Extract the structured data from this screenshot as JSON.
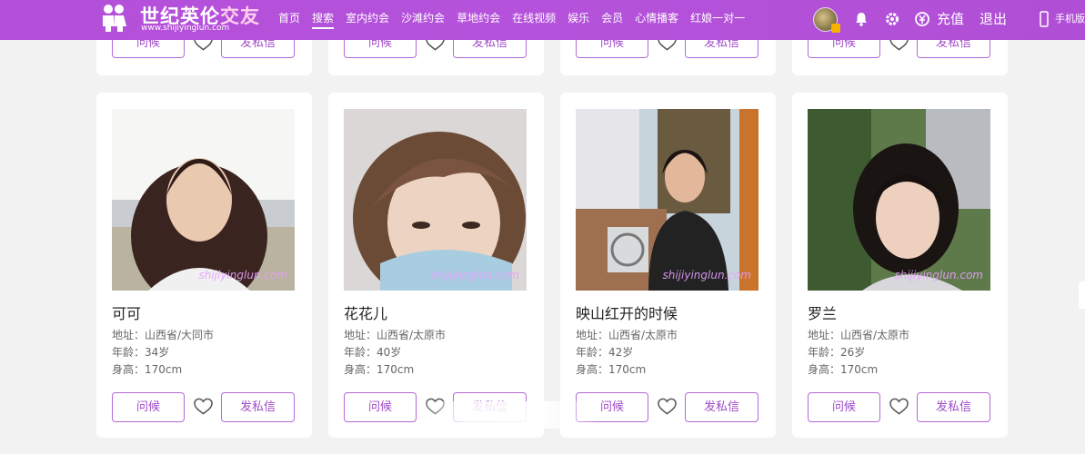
{
  "header": {
    "logo_title_main": "世纪英伦",
    "logo_title_accent": "交友",
    "logo_url": "www.shijiyinglun.com",
    "nav": [
      {
        "label": "首页",
        "active": false
      },
      {
        "label": "搜索",
        "active": true
      },
      {
        "label": "室内约会",
        "active": false
      },
      {
        "label": "沙滩约会",
        "active": false
      },
      {
        "label": "草地约会",
        "active": false
      },
      {
        "label": "在线视频",
        "active": false
      },
      {
        "label": "娱乐",
        "active": false
      },
      {
        "label": "会员",
        "active": false
      },
      {
        "label": "心情播客",
        "active": false
      },
      {
        "label": "红娘一对一",
        "active": false
      }
    ],
    "recharge_label": "充值",
    "logout_label": "退出",
    "mobile_label": "手机版"
  },
  "buttons": {
    "greet": "问候",
    "message": "发私信"
  },
  "watermark": "shijiyinglun.com",
  "labels": {
    "address": "地址：",
    "age": "年龄：",
    "height": "身高："
  },
  "profiles": [
    {
      "name": "可可",
      "address": "山西省/大同市",
      "age": "34岁",
      "height": "170cm"
    },
    {
      "name": "花花儿",
      "address": "山西省/太原市",
      "age": "40岁",
      "height": "170cm"
    },
    {
      "name": "映山红开的时候",
      "address": "山西省/太原市",
      "age": "42岁",
      "height": "170cm"
    },
    {
      "name": "罗兰",
      "address": "山西省/太原市",
      "age": "26岁",
      "height": "170cm"
    }
  ],
  "colors": {
    "brand": "#b34fd9",
    "button_border": "#b468d8",
    "button_text": "#a04cc8"
  }
}
